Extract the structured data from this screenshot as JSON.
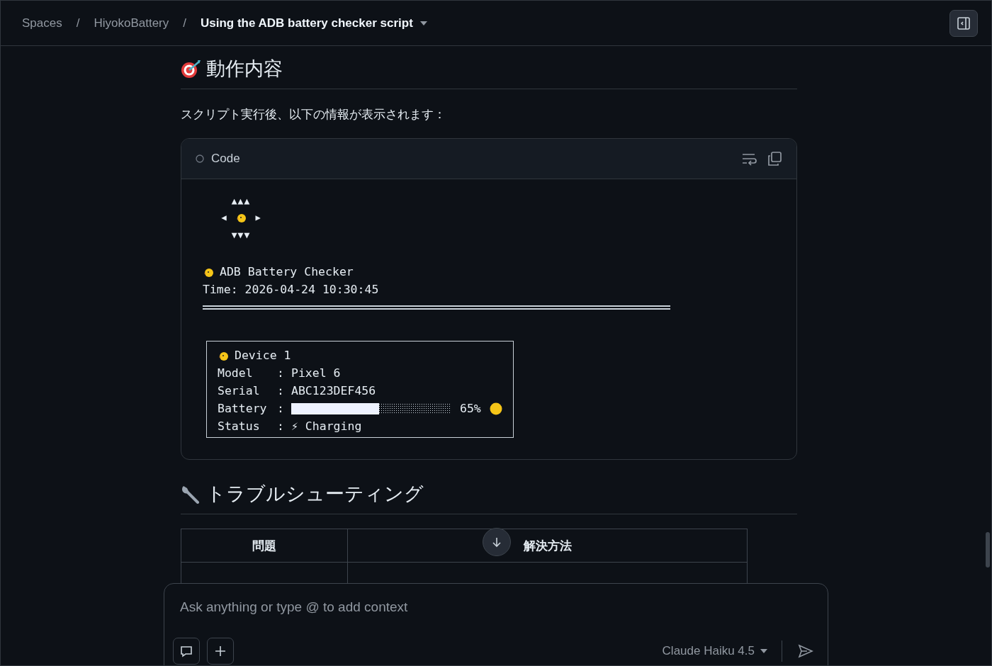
{
  "breadcrumbs": [
    {
      "label": "Spaces",
      "current": false
    },
    {
      "label": "HiyokoBattery",
      "current": false
    },
    {
      "label": "Using the ADB battery checker script",
      "current": true
    }
  ],
  "breadcrumb_separator": "/",
  "section1": {
    "title": "動作内容",
    "intro": "スクリプト実行後、以下の情報が表示されます："
  },
  "code_block": {
    "label": "Code",
    "art": {
      "top": "▲▲▲",
      "left": "◀",
      "right": "▶",
      "bottom": "▼▼▼"
    },
    "title": "ADB Battery Checker",
    "time": "Time: 2026-04-24 10:30:45",
    "device": {
      "title": "Device 1",
      "rows": [
        {
          "kind": "text",
          "label": "Model",
          "sep": ":",
          "value": "Pixel 6"
        },
        {
          "kind": "text",
          "label": "Serial",
          "sep": ":",
          "value": "ABC123DEF456"
        },
        {
          "kind": "bar",
          "label": "Battery",
          "sep": ":",
          "level": 0.55,
          "reading": "65%"
        },
        {
          "kind": "text",
          "label": "Status",
          "sep": ":",
          "value": "⚡ Charging"
        }
      ]
    }
  },
  "section2": {
    "title": "トラブルシューティング",
    "table": {
      "columns": [
        "問題",
        "解決方法"
      ]
    }
  },
  "composer": {
    "placeholder": "Ask anything or type @ to add context",
    "model": "Claude Haiku 4.5"
  }
}
